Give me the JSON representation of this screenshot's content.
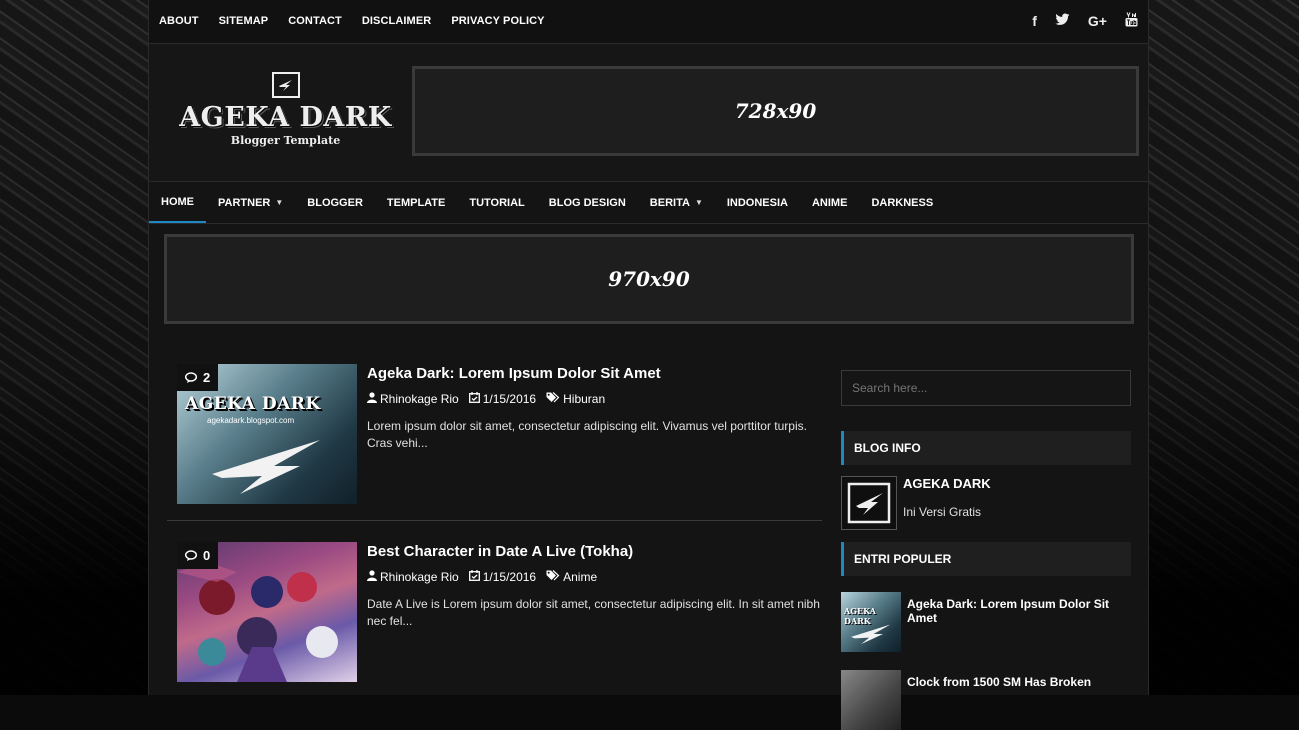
{
  "top_nav": [
    "ABOUT",
    "SITEMAP",
    "CONTACT",
    "DISCLAIMER",
    "PRIVACY POLICY"
  ],
  "social": [
    "facebook-icon",
    "twitter-icon",
    "google-plus-icon",
    "youtube-icon"
  ],
  "social_labels": {
    "facebook": "f",
    "googleplus": "G+"
  },
  "logo": {
    "title": "AGEKA DARK",
    "subtitle": "Blogger Template"
  },
  "ads": {
    "header": "728x90",
    "banner": "970x90"
  },
  "main_nav": [
    {
      "label": "HOME",
      "active": true
    },
    {
      "label": "PARTNER",
      "dropdown": true
    },
    {
      "label": "BLOGGER"
    },
    {
      "label": "TEMPLATE"
    },
    {
      "label": "TUTORIAL"
    },
    {
      "label": "BLOG DESIGN"
    },
    {
      "label": "BERITA",
      "dropdown": true
    },
    {
      "label": "INDONESIA"
    },
    {
      "label": "ANIME"
    },
    {
      "label": "DARKNESS"
    }
  ],
  "posts": [
    {
      "title": "Ageka Dark: Lorem Ipsum Dolor Sit Amet",
      "comments": "2",
      "author": "Rhinokage Rio",
      "date": "1/15/2016",
      "label": "Hiburan",
      "snippet": "Lorem ipsum dolor sit amet, consectetur adipiscing elit. Vivamus vel porttitor turpis. Cras vehi...",
      "thumb_text": "AGEKA DARK",
      "thumb_url": "agekadark.blogspot.com"
    },
    {
      "title": "Best Character in Date A Live (Tokha)",
      "comments": "0",
      "author": "Rhinokage Rio",
      "date": "1/15/2016",
      "label": "Anime",
      "snippet": "Date A Live is Lorem ipsum dolor sit amet, consectetur adipiscing elit. In sit amet nibh nec fel..."
    }
  ],
  "sidebar": {
    "search_placeholder": "Search here...",
    "blog_info": {
      "heading": "BLOG INFO",
      "title": "AGEKA DARK",
      "desc": "Ini Versi Gratis"
    },
    "popular": {
      "heading": "ENTRI POPULER",
      "items": [
        {
          "title": "Ageka Dark: Lorem Ipsum Dolor Sit Amet",
          "thumb_text": "AGEKA DARK"
        },
        {
          "title": "Clock from 1500 SM Has Broken"
        }
      ]
    }
  },
  "colors": {
    "accent": "#1e88c7",
    "background": "#141414"
  }
}
